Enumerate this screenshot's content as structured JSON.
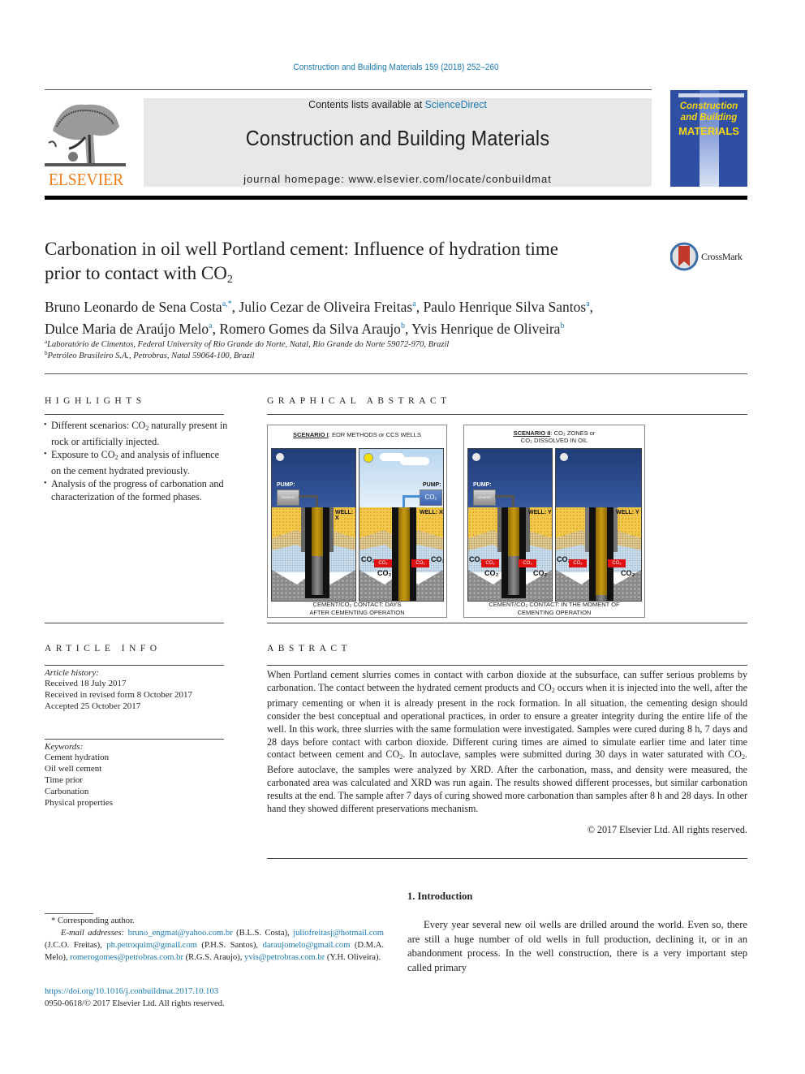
{
  "header": {
    "journal_reference": "Construction and Building Materials 159 (2018) 252–260",
    "contents_prefix": "Contents lists available at ",
    "contents_link": "ScienceDirect",
    "journal_title": "Construction and Building Materials",
    "homepage_label": "journal homepage: ",
    "homepage_url": "www.elsevier.com/locate/conbuildmat",
    "publisher_logo_text": "ELSEVIER",
    "cover": {
      "line1": "Construction",
      "line2": "and Building",
      "line3": "MATERIALS"
    },
    "crossmark_label": "CrossMark",
    "colors": {
      "link": "#1a7ab3",
      "elsevier_orange": "#ef7d1a",
      "cover_blue": "#2e4fa3",
      "cover_yellow": "#f5d60f"
    }
  },
  "article": {
    "title_line1": "Carbonation in oil well Portland cement: Influence of hydration time",
    "title_line2_prefix": "prior to contact with CO",
    "title_line2_sub": "2",
    "authors": [
      {
        "name": "Bruno Leonardo de Sena Costa",
        "sup": "a,*",
        "sep": ", "
      },
      {
        "name": "Julio Cezar de Oliveira Freitas",
        "sup": "a",
        "sep": ", "
      },
      {
        "name": "Paulo Henrique Silva Santos",
        "sup": "a",
        "sep": ","
      },
      {
        "name": "Dulce Maria de Araújo Melo",
        "sup": "a",
        "sep": ", "
      },
      {
        "name": "Romero Gomes da Silva Araujo",
        "sup": "b",
        "sep": ", "
      },
      {
        "name": "Yvis Henrique de Oliveira",
        "sup": "b",
        "sep": ""
      }
    ],
    "affiliations": [
      {
        "sup": "a",
        "text": "Laboratório de Cimentos, Federal University of Rio Grande do Norte, Natal, Rio Grande do Norte 59072-970, Brazil"
      },
      {
        "sup": "b",
        "text": "Petróleo Brasileiro S.A., Petrobras, Natal 59064-100, Brazil"
      }
    ]
  },
  "highlights": {
    "heading": "HIGHLIGHTS",
    "items": [
      {
        "pre": "Different scenarios: CO",
        "sub": "2",
        "post": " naturally present in rock or artificially injected."
      },
      {
        "pre": "Exposure to CO",
        "sub": "2",
        "post": " and analysis of influence on the cement hydrated previously."
      },
      {
        "pre": "Analysis of the progress of carbonation and characterization of the formed phases.",
        "sub": "",
        "post": ""
      }
    ]
  },
  "graphical_abstract": {
    "heading": "GRAPHICAL ABSTRACT",
    "scenario1": {
      "title_bold": "SCENARIO I",
      "title_rest": ": EOR METHODS or CCS WELLS",
      "pump_left": "PUMP:",
      "pump_left_box": "CEMENT",
      "pump_right": "PUMP:",
      "pump_right_box": "CO₂",
      "well_label": "WELL: X",
      "co2": "CO₂",
      "caption_line1": "CEMENT/CO₂ CONTACT: DAYS",
      "caption_line2": "AFTER CEMENTING OPERATION"
    },
    "scenario2": {
      "title_bold": "SCENARIO II",
      "title_rest": ": CO₂ ZONES or",
      "title_line2": "CO₂ DISSOLVED IN OIL",
      "pump_left": "PUMP:",
      "pump_left_box": "CEMENT",
      "well_label": "WELL: Y",
      "co2": "CO₂",
      "caption_line1": "CEMENT/CO₂ CONTACT: IN THE MOMENT OF",
      "caption_line2": "CEMENTING OPERATION"
    }
  },
  "article_info": {
    "heading": "ARTICLE INFO",
    "history_label": "Article history:",
    "received": "Received 18 July 2017",
    "revised": "Received in revised form 8 October 2017",
    "accepted": "Accepted 25 October 2017",
    "keywords_label": "Keywords:",
    "keywords": [
      "Cement hydration",
      "Oil well cement",
      "Time prior",
      "Carbonation",
      "Physical properties"
    ]
  },
  "abstract": {
    "heading": "ABSTRACT",
    "p1": "When Portland cement slurries comes in contact with carbon dioxide at the subsurface, can suffer serious problems by carbonation. The contact between the hydrated cement products and CO",
    "p2": " occurs when it is injected into the well, after the primary cementing or when it is already present in the rock formation. In all situation, the cementing design should consider the best conceptual and operational practices, in order to ensure a greater integrity during the entire life of the well. In this work, three slurries with the same formulation were investigated. Samples were cured during 8 h, 7 days and 28 days before contact with carbon dioxide. Different curing times are aimed to simulate earlier time and later time contact between cement and CO",
    "p3": ". In autoclave, samples were submitted during 30 days in water saturated with CO",
    "p4": ". Before autoclave, the samples were analyzed by XRD. After the carbonation, mass, and density were measured, the carbonated area was calculated and XRD was run again. The results showed different processes, but similar carbonation results at the end. The sample after 7 days of curing showed more carbonation than samples after 8 h and 28 days. In other hand they showed different preservations mechanism.",
    "sub": "2",
    "copyright": "© 2017 Elsevier Ltd. All rights reserved."
  },
  "footnotes": {
    "corresponding": "* Corresponding author.",
    "email_label": "E-mail addresses:",
    "emails": [
      {
        "email": "bruno_engmat@yahoo.com.br",
        "who": " (B.L.S. Costa), "
      },
      {
        "email": "juliofreitasj@hotmail.com",
        "who": " (J.C.O. Freitas), "
      },
      {
        "email": "ph.petroquim@gmail.com",
        "who": " (P.H.S. Santos), "
      },
      {
        "email": "daraujomelo@gmail.com",
        "who": " (D.M.A. Melo), "
      },
      {
        "email": "romerogomes@petrobras.com.br",
        "who": " (R.G.S. Araujo), "
      },
      {
        "email": "yvis@petrobras.com.br",
        "who": " (Y.H. Oliveira)."
      }
    ],
    "doi": "https://doi.org/10.1016/j.conbuildmat.2017.10.103",
    "issn": "0950-0618/© 2017 Elsevier Ltd. All rights reserved."
  },
  "introduction": {
    "heading": "1. Introduction",
    "text": "Every year several new oil wells are drilled around the world. Even so, there are still a huge number of old wells in full production, declining it, or in an abandonment process. In the well construction, there is a very important step called primary"
  }
}
